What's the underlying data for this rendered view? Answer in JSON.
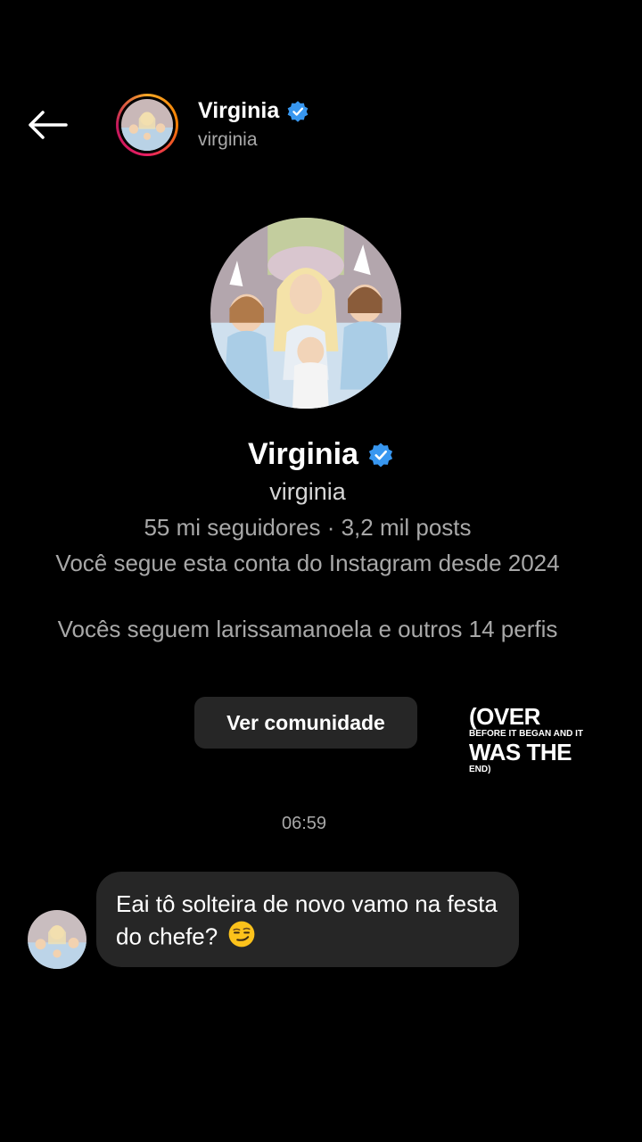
{
  "header": {
    "name": "Virginia",
    "handle": "virginia"
  },
  "profile": {
    "name": "Virginia",
    "handle": "virginia",
    "stats": "55 mi seguidores · 3,2 mil posts",
    "follow_since": "Você segue esta conta do Instagram desde 2024",
    "mutual": "Vocês seguem larissamanoela e outros 14 perfis",
    "community_button": "Ver comunidade"
  },
  "overlay_caption": {
    "line1": "(OVER",
    "line2": "BEFORE IT BEGAN AND IT",
    "line3": "WAS THE",
    "line4": "END)"
  },
  "chat": {
    "timestamp": "06:59",
    "messages": [
      {
        "text": "Eai tô solteira de novo vamo na festa do chefe?"
      }
    ]
  },
  "colors": {
    "background": "#000000",
    "bubble": "#262626",
    "verified": "#3897f0",
    "secondary_text": "#a8a8a8"
  },
  "icons": [
    "back-arrow-icon",
    "verified-badge-icon",
    "smirk-emoji-icon"
  ]
}
